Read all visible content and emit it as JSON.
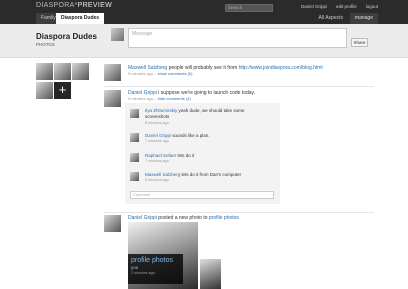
{
  "topbar": {
    "logo_main": "DIASPORA*",
    "logo_preview": "PREVIEW",
    "search_placeholder": "Search",
    "user_links": [
      "Daniel Grippi",
      "edit profile",
      "logout"
    ],
    "tabs": [
      "Family",
      "Diaspora Dudes"
    ],
    "right_tabs": [
      "All Aspects",
      "manage"
    ]
  },
  "header": {
    "title": "Diaspora Dudes",
    "subtitle": "PHOTOS",
    "message_placeholder": "Message",
    "share_label": "Share"
  },
  "posts": [
    {
      "author": "Maxwell Salzberg",
      "text": "people will probably see it from",
      "url": "http://www.joindiaspora.com/blog.html",
      "time": "5 minutes ago",
      "link": "show comments (0)"
    },
    {
      "author": "Daniel Grippi",
      "text": "i suppose we're going to launch code today.",
      "time": "5 minutes ago",
      "link": "hide comments (4)"
    }
  ],
  "comments": [
    {
      "author": "Ilya Zhitomirskiy",
      "text": "yeah dude, we should take some",
      "text2": "screenshots",
      "time": "8 minutes ago"
    },
    {
      "author": "Daniel Grippi",
      "text": "sounds like a plan.",
      "time": "7 minutes ago"
    },
    {
      "author": "Raphael Sofaer",
      "text": "lets do it",
      "time": "7 minutes ago"
    },
    {
      "author": "Maxwell Salzberg",
      "text": "lets do it from Dan's computer",
      "time": "5 minutes ago"
    }
  ],
  "comment_placeholder": "Comment",
  "photo_post": {
    "author": "Daniel Grippi",
    "text_a": "posted a new photo to",
    "album": "profile photos",
    "card_title": "profile photos",
    "card_sub": "you",
    "card_time": "2 minutes ago"
  }
}
